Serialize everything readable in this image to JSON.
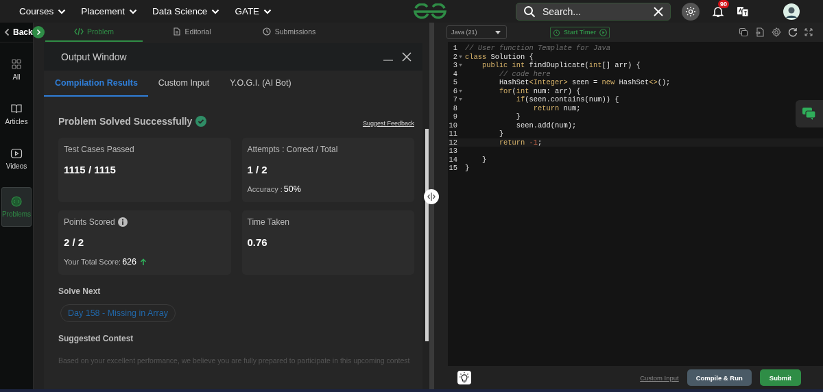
{
  "top_nav": {
    "menus": [
      {
        "label": "Courses"
      },
      {
        "label": "Placement"
      },
      {
        "label": "Data Science"
      },
      {
        "label": "GATE"
      }
    ],
    "search": {
      "placeholder": "Search..."
    },
    "notifications": "90"
  },
  "rail": {
    "back": "Back",
    "items": [
      {
        "label": "All",
        "selected": false
      },
      {
        "label": "Articles",
        "selected": false
      },
      {
        "label": "Videos",
        "selected": false
      },
      {
        "label": "Problems",
        "selected": true
      }
    ]
  },
  "problem_tabs": [
    {
      "label": "Problem",
      "selected": true
    },
    {
      "label": "Editorial",
      "selected": false
    },
    {
      "label": "Submissions",
      "selected": false
    }
  ],
  "output_window": {
    "title": "Output Window",
    "tabs": [
      {
        "label": "Compilation Results",
        "selected": true
      },
      {
        "label": "Custom Input",
        "selected": false
      },
      {
        "label": "Y.O.G.I. (AI Bot)",
        "selected": false
      }
    ],
    "status": "Problem Solved Successfully",
    "feedback_link": "Suggest Feedback",
    "cards": [
      {
        "label": "Test Cases Passed",
        "value": "1115 / 1115",
        "info": false
      },
      {
        "label": "Attempts : Correct / Total",
        "value": "1 / 2",
        "info": false,
        "note_label": "Accuracy : ",
        "note_value": "50%",
        "trend_up": false
      },
      {
        "label": "Points Scored",
        "value": "2 / 2",
        "info": true,
        "note_label": "Your Total Score: ",
        "note_value": "626",
        "trend_up": true
      },
      {
        "label": "Time Taken",
        "value": "0.76",
        "info": false
      }
    ],
    "solve_next": {
      "heading": "Solve Next",
      "chip": "Day 158 - Missing in Array"
    },
    "contest": {
      "heading": "Suggested Contest",
      "text": "Based on your excellent performance, we believe you are fully prepared to participate in this upcoming contest"
    }
  },
  "editor": {
    "language": "Java (21)",
    "timer": "Start Timer",
    "lines": [
      {
        "number": "1",
        "foldable": false,
        "current": false,
        "tokens": [
          {
            "text": "// User function Template for Java",
            "kind": "comment"
          }
        ]
      },
      {
        "number": "2",
        "foldable": true,
        "current": false,
        "tokens": [
          {
            "text": "class",
            "kind": "keyword"
          },
          {
            "text": " Solution {",
            "kind": "plain"
          }
        ]
      },
      {
        "number": "3",
        "foldable": true,
        "current": false,
        "tokens": [
          {
            "text": "    public int",
            "kind": "keyword"
          },
          {
            "text": " findDuplicate(",
            "kind": "plain"
          },
          {
            "text": "int",
            "kind": "keyword"
          },
          {
            "text": "[] arr) {",
            "kind": "plain"
          }
        ]
      },
      {
        "number": "4",
        "foldable": false,
        "current": false,
        "tokens": [
          {
            "text": "        // code here",
            "kind": "comment"
          }
        ]
      },
      {
        "number": "5",
        "foldable": false,
        "current": false,
        "tokens": [
          {
            "text": "        HashSet",
            "kind": "plain"
          },
          {
            "text": "<Integer>",
            "kind": "keyword"
          },
          {
            "text": " seen = ",
            "kind": "plain"
          },
          {
            "text": "new",
            "kind": "keyword"
          },
          {
            "text": " HashSet",
            "kind": "plain"
          },
          {
            "text": "<>",
            "kind": "keyword"
          },
          {
            "text": "();",
            "kind": "plain"
          }
        ]
      },
      {
        "number": "6",
        "foldable": true,
        "current": false,
        "tokens": [
          {
            "text": "        for",
            "kind": "keyword"
          },
          {
            "text": "(",
            "kind": "plain"
          },
          {
            "text": "int",
            "kind": "keyword"
          },
          {
            "text": " num: arr) {",
            "kind": "plain"
          }
        ]
      },
      {
        "number": "7",
        "foldable": true,
        "current": false,
        "tokens": [
          {
            "text": "            if",
            "kind": "keyword"
          },
          {
            "text": "(seen.contains(num)) {",
            "kind": "plain"
          }
        ]
      },
      {
        "number": "8",
        "foldable": false,
        "current": false,
        "tokens": [
          {
            "text": "                return",
            "kind": "keyword"
          },
          {
            "text": " num;",
            "kind": "plain"
          }
        ]
      },
      {
        "number": "9",
        "foldable": false,
        "current": false,
        "tokens": [
          {
            "text": "            }",
            "kind": "plain"
          }
        ]
      },
      {
        "number": "10",
        "foldable": false,
        "current": false,
        "tokens": [
          {
            "text": "            seen.add(num);",
            "kind": "plain"
          }
        ]
      },
      {
        "number": "11",
        "foldable": false,
        "current": false,
        "tokens": [
          {
            "text": "        }",
            "kind": "plain"
          }
        ]
      },
      {
        "number": "12",
        "foldable": false,
        "current": true,
        "tokens": [
          {
            "text": "        return",
            "kind": "keyword"
          },
          {
            "text": " -1",
            "kind": "number"
          },
          {
            "text": ";",
            "kind": "plain"
          }
        ]
      },
      {
        "number": "13",
        "foldable": false,
        "current": false
      },
      {
        "number": "14",
        "foldable": false,
        "current": false,
        "tokens": [
          {
            "text": "    }",
            "kind": "plain"
          }
        ]
      },
      {
        "number": "15",
        "foldable": false,
        "current": false,
        "tokens": [
          {
            "text": "}",
            "kind": "plain"
          }
        ]
      }
    ],
    "custom_input": "Custom Input",
    "compile": "Compile & Run",
    "submit": "Submit"
  }
}
